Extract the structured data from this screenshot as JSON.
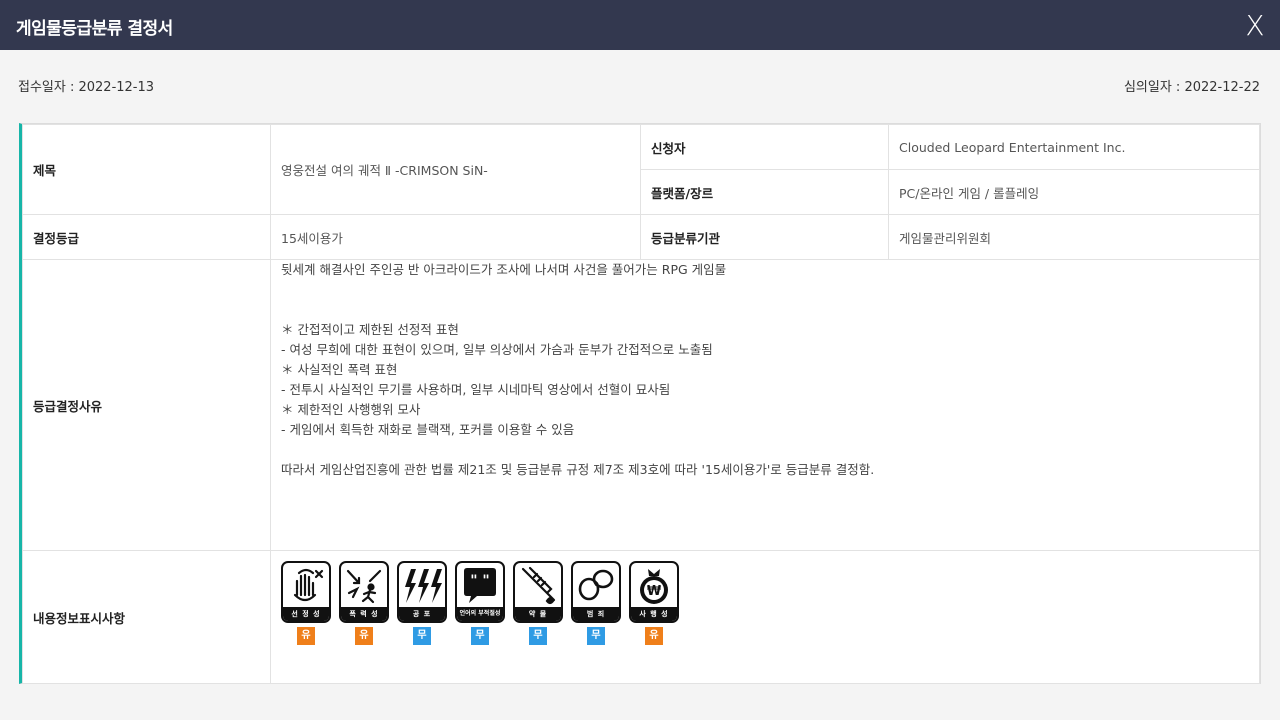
{
  "window": {
    "title": "게임물등급분류 결정서",
    "close_label": "X"
  },
  "dates": {
    "received": "접수일자 : 2022-12-13",
    "reviewed": "심의일자 : 2022-12-22"
  },
  "rows": {
    "title_label": "제목",
    "title_value": "영웅전설 여의 궤적 Ⅱ -CRIMSON SiN-",
    "applicant_label": "신청자",
    "applicant_value": "Clouded Leopard Entertainment Inc.",
    "platform_label": "플랫폼/장르",
    "platform_value": "PC/온라인 게임 / 롤플레잉",
    "rating_label": "결정등급",
    "rating_value": "15세이용가",
    "agency_label": "등급분류기관",
    "agency_value": "게임물관리위원회",
    "reason_label": "등급결정사유",
    "content_label": "내용정보표시사항"
  },
  "reason_lines": [
    "뒷세계 해결사인 주인공 반 아크라이드가 조사에 나서며 사건을 풀어가는 RPG 게임물",
    "",
    "",
    "＊ 간접적이고 제한된 선정적 표현",
    "- 여성 무희에 대한 표현이 있으며, 일부 의상에서 가슴과 둔부가 간접적으로 노출됨",
    "＊ 사실적인 폭력 표현",
    "- 전투시 사실적인 무기를 사용하며, 일부 시네마틱 영상에서 선혈이 묘사됨",
    "＊ 제한적인 사행행위 모사",
    "- 게임에서 획득한 재화로 블랙잭, 포커를 이용할 수 있음",
    "",
    "따라서 게임산업진흥에 관한 법률 제21조 및 등급분류 규정 제7조 제3호에 따라 '15세이용가'로 등급분류 결정함."
  ],
  "content_icons": [
    {
      "name": "sexuality-icon",
      "caption": "선 정 성",
      "badge": "유",
      "present": true
    },
    {
      "name": "violence-icon",
      "caption": "폭 력 성",
      "badge": "유",
      "present": true
    },
    {
      "name": "fear-icon",
      "caption": "공 포",
      "badge": "무",
      "present": false
    },
    {
      "name": "language-icon",
      "caption": "언어의 부적절성",
      "badge": "무",
      "present": false
    },
    {
      "name": "drug-icon",
      "caption": "약 물",
      "badge": "무",
      "present": false
    },
    {
      "name": "crime-icon",
      "caption": "범 죄",
      "badge": "무",
      "present": false
    },
    {
      "name": "gambling-icon",
      "caption": "사 행 성",
      "badge": "유",
      "present": true
    }
  ],
  "colors": {
    "titlebar": "#33384f",
    "accent": "#17b5a8",
    "badge_yes": "#ef7f1a",
    "badge_no": "#2f9be4"
  }
}
